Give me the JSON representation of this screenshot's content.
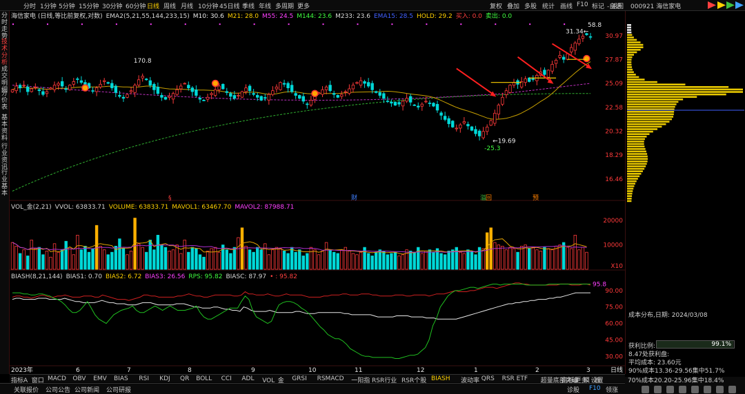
{
  "top_tabs": [
    "分时",
    "1分钟",
    "5分钟",
    "15分钟",
    "30分钟",
    "60分钟",
    "日线",
    "周线",
    "月线",
    "10分钟",
    "45日线",
    "季线",
    "年线",
    "多周期",
    "更多"
  ],
  "active_tab": "日线",
  "right_tabs": [
    "复权",
    "叠加",
    "多股",
    "统计",
    "画线",
    "F10",
    "标记",
    "-自选",
    "返回"
  ],
  "code_label": "000921 海信家电",
  "left_tabs": [
    "分时走势",
    "技术分析",
    "成交明细",
    "分价表",
    "基本资料",
    "行业资讯",
    "行业基本"
  ],
  "active_left": "技术分析",
  "main_legend": [
    {
      "t": "海信家电 (日线,等比前复权,对数)",
      "c": "#d8d8d8"
    },
    {
      "t": "EMA2(5,21,55,144,233,15)",
      "c": "#d8d8d8"
    },
    {
      "t": "M10: 30.6",
      "c": "#e8e8e8"
    },
    {
      "t": "M21: 28.0",
      "c": "#ffd000"
    },
    {
      "t": "M55: 24.5",
      "c": "#ff40ff"
    },
    {
      "t": "M144: 23.6",
      "c": "#40ff40"
    },
    {
      "t": "M233: 23.6",
      "c": "#d8d8d8"
    },
    {
      "t": "EMA15: 28.5",
      "c": "#4060ff"
    },
    {
      "t": "HOLD: 29.2",
      "c": "#ffd000"
    },
    {
      "t": "买入: 0.0",
      "c": "#ff4040"
    },
    {
      "t": "卖出: 0.0",
      "c": "#40ff40"
    }
  ],
  "price_axis": [
    "30.97",
    "27.87",
    "25.09",
    "22.58",
    "20.32",
    "18.29",
    "16.46"
  ],
  "annotations": {
    "high1": "170.8",
    "low1": "19.69",
    "low2": "-25.3",
    "last_high": "58.8",
    "last_price": "31.34"
  },
  "event_marks": [
    {
      "t": "§",
      "c": "#ff4040"
    },
    {
      "t": "财",
      "c": "#4080ff"
    },
    {
      "t": "溢",
      "c": "#40c040"
    },
    {
      "t": "回",
      "c": "#ff8000"
    },
    {
      "t": "预",
      "c": "#ff8000"
    }
  ],
  "vol_legend": [
    {
      "t": "VOL_金(2,21)",
      "c": "#d8d8d8"
    },
    {
      "t": "VVOL: 63833.71",
      "c": "#d8d8d8"
    },
    {
      "t": "VOLUME: 63833.71",
      "c": "#ffd000"
    },
    {
      "t": "MAVOL1: 63467.70",
      "c": "#ffd000"
    },
    {
      "t": "MAVOL2: 87988.71",
      "c": "#ff40ff"
    }
  ],
  "vol_axis": [
    "20000",
    "10000"
  ],
  "vol_unit": "X10",
  "bias_legend": [
    {
      "t": "BIASH(8,21,144)",
      "c": "#d8d8d8"
    },
    {
      "t": "BIAS1: 0.70",
      "c": "#d8d8d8"
    },
    {
      "t": "BIAS2: 6.72",
      "c": "#ffd000"
    },
    {
      "t": "BIAS3: 26.56",
      "c": "#ff40ff"
    },
    {
      "t": "RPS: 95.82",
      "c": "#40ff40"
    },
    {
      "t": "BIASC: 87.97",
      "c": "#d8d8d8"
    },
    {
      "t": "• : 95.82",
      "c": "#ff4040"
    }
  ],
  "bias_axis": [
    "90.00",
    "75.00",
    "60.00",
    "45.00",
    "30.00"
  ],
  "bias_last": "95.8",
  "date_axis": [
    "2023年",
    "6",
    "7",
    "8",
    "9",
    "10",
    "11",
    "12",
    "1",
    "2",
    "3"
  ],
  "date_axis_right": "日线",
  "bottom_tabs": [
    "指标A",
    "窗口",
    "MACD",
    "OBV",
    "EMV",
    "BIAS",
    "RSI",
    "KDJ",
    "QR",
    "BOLL",
    "CCI",
    "ADL",
    "VOL_金",
    "GRSI",
    "RSMACD",
    "一阳指",
    "RSR行业",
    "RSR个股",
    "BIASH",
    "波动率",
    "QRS",
    "RSR ETF",
    "超量底部突破",
    "更多",
    "设置"
  ],
  "active_bottom": "BIASH",
  "bottom_right_tabs": [
    "指标B",
    "模",
    "板"
  ],
  "bottom2": [
    "关联报价",
    "公司公告",
    "公司新闻",
    "公司研报"
  ],
  "bottom2_right": [
    "诊股",
    "F10",
    "领涨"
  ],
  "dist_panel": {
    "title": "成本分布,日期: 2024/03/08",
    "profit_label": "获利比例:",
    "profit_value": "99.1%",
    "profit_ratio": 0.991,
    "line3": "8.47处获利盘:",
    "avg_label": "平均成本: 23.60元",
    "line90": "90%成本13.36-29.56集中51.7%",
    "line70": "70%成本20.20-25.96集中18.4%"
  },
  "colors": {
    "up": "#ff3a3a",
    "down": "#00d8d8",
    "bg": "#000000",
    "grid": "#3a1010",
    "white": "#e8e8e8",
    "yellow": "#ffd000",
    "magenta": "#ff40ff",
    "green": "#40ff40"
  },
  "chart_data": [
    {
      "type": "candlestick",
      "title": "海信家电 (日线,等比前复权,对数)",
      "y_axis": [
        30.97,
        27.87,
        25.09,
        22.58,
        20.32,
        18.29,
        16.46
      ],
      "y_scale": "log",
      "x_labels": [
        "2023年",
        "6",
        "7",
        "8",
        "9",
        "10",
        "11",
        "12",
        "1",
        "2",
        "3"
      ],
      "closes": [
        24.4,
        24.8,
        24.6,
        24.9,
        24.2,
        24.5,
        24.7,
        24.3,
        23.9,
        24.2,
        24.6,
        24.9,
        25.1,
        24.8,
        24.5,
        24.9,
        25.3,
        25.6,
        25.2,
        24.9,
        24.6,
        24.3,
        24.6,
        25.0,
        25.4,
        25.1,
        24.6,
        24.1,
        23.7,
        23.5,
        23.9,
        24.3,
        24.9,
        25.5,
        25.9,
        25.5,
        24.9,
        24.4,
        24.0,
        23.6,
        23.4,
        23.7,
        24.0,
        24.4,
        24.8,
        25.1,
        24.6,
        24.2,
        23.8,
        23.4,
        23.3,
        23.6,
        24.0,
        24.4,
        24.8,
        24.5,
        24.1,
        23.7,
        23.5,
        23.8,
        24.2,
        24.6,
        24.3,
        23.9,
        23.6,
        23.3,
        23.5,
        23.9,
        24.3,
        24.7,
        25.2,
        25.0,
        24.6,
        24.2,
        23.8,
        23.5,
        23.2,
        22.9,
        23.3,
        23.7,
        24.1,
        24.4,
        24.7,
        24.3,
        23.9,
        23.6,
        23.9,
        24.2,
        24.5,
        24.9,
        25.2,
        25.4,
        25.1,
        24.8,
        24.4,
        24.1,
        23.8,
        23.5,
        23.2,
        23.0,
        22.8,
        22.9,
        23.2,
        23.5,
        23.1,
        22.8,
        22.6,
        22.9,
        23.2,
        23.0,
        22.7,
        22.3,
        21.8,
        21.4,
        21.0,
        20.7,
        20.6,
        20.9,
        21.2,
        20.8,
        20.4,
        20.1,
        19.9,
        20.3,
        20.7,
        21.3,
        22.0,
        22.8,
        23.6,
        24.3,
        24.9,
        25.2,
        25.0,
        25.3,
        25.6,
        25.3,
        25.6,
        26.0,
        26.4,
        26.1,
        26.6,
        27.3,
        27.8,
        28.4,
        27.9,
        28.6,
        29.4,
        30.0,
        30.5,
        30.9,
        31.1,
        30.8
      ]
    },
    {
      "type": "bar",
      "title": "VOL_金(2,21)",
      "y_axis": [
        20000,
        10000
      ],
      "unit": "X10",
      "values": [
        11000,
        9500,
        6500,
        8000,
        5500,
        12000,
        8500,
        9000,
        6000,
        7500,
        5000,
        10500,
        7000,
        8000,
        11500,
        9000,
        6000,
        14000,
        8000,
        9500,
        7000,
        8500,
        18000,
        9500,
        8000,
        6000,
        7000,
        9500,
        12500,
        8500,
        6000,
        7500,
        21000,
        10500,
        9000,
        7000,
        12000,
        8000,
        14000,
        10000,
        9000,
        7500,
        8000,
        10000,
        6500,
        12000,
        7000,
        9000,
        8500,
        6000,
        5000,
        7500,
        8500,
        9000,
        7000,
        10000,
        8000,
        6500,
        9000,
        13000,
        17000,
        9500,
        8000,
        7000,
        9000,
        8000,
        10500,
        6000,
        8000,
        9000,
        8500,
        7500,
        6500,
        9000,
        7000,
        8000,
        5500,
        6500,
        9000,
        8000,
        6000,
        7500,
        11000,
        8000,
        7000,
        6500,
        8000,
        9000,
        7500,
        6500,
        6000,
        7000,
        9000,
        6500,
        5500,
        7000,
        8000,
        7500,
        6000,
        6500,
        7000,
        5500,
        6000,
        8000,
        7500,
        7000,
        9000,
        6500,
        7500,
        8000,
        7000,
        8500,
        6500,
        6000,
        7500,
        8000,
        9000,
        7000,
        6500,
        8000,
        7500,
        6000,
        9000,
        8500,
        15000,
        17000,
        11000,
        10000,
        9500,
        8000,
        9000,
        8500,
        7000,
        9500,
        10000,
        8500,
        9000,
        8000,
        7500,
        9000,
        8500,
        8000,
        9500,
        10000,
        11000,
        9000,
        8500,
        14000,
        8000,
        9000,
        7000
      ]
    },
    {
      "type": "line",
      "title": "BIASH(8,21,144)",
      "y_axis": [
        90,
        75,
        60,
        45,
        30
      ],
      "series": [
        {
          "name": "BIAS2",
          "values": [
            84,
            85,
            85,
            84,
            84,
            83,
            84,
            85,
            86,
            85,
            84,
            84,
            85,
            85,
            86,
            85,
            84,
            84,
            84,
            85,
            85,
            85,
            84,
            84,
            86,
            85,
            84,
            83,
            82,
            82,
            82,
            81,
            82,
            83,
            84,
            86,
            86,
            85,
            85,
            84,
            84,
            84,
            84,
            84,
            85,
            85,
            86,
            87,
            86,
            85,
            85,
            84,
            84,
            85,
            86,
            86,
            86,
            86,
            86,
            85,
            85,
            86,
            89,
            87,
            87,
            86,
            86,
            86,
            87,
            86,
            85,
            85,
            86,
            87,
            86,
            86,
            86,
            86,
            85,
            84,
            84,
            84,
            84,
            85,
            85,
            86,
            86,
            86,
            87,
            87,
            86,
            86,
            86,
            87,
            87,
            87,
            86,
            86,
            85,
            85,
            85,
            85,
            86,
            86,
            86,
            85,
            85,
            86,
            86,
            86,
            86,
            85,
            86,
            87,
            87,
            87,
            88,
            89,
            90,
            89,
            89,
            89,
            90,
            90,
            91,
            92,
            93,
            93,
            93,
            92,
            93,
            94,
            95,
            96,
            97,
            97,
            96,
            96,
            95,
            95,
            95,
            95,
            95,
            95,
            95,
            95,
            96,
            96,
            96,
            95,
            95,
            95,
            96,
            96,
            95
          ]
        },
        {
          "name": "BIASC",
          "values": [
            82,
            83,
            83,
            82,
            82,
            82,
            82,
            83,
            83,
            83,
            82,
            82,
            82,
            82,
            83,
            82,
            81,
            80,
            80,
            79,
            79,
            79,
            79,
            80,
            81,
            80,
            79,
            79,
            78,
            78,
            78,
            77,
            77,
            77,
            78,
            79,
            79,
            79,
            78,
            77,
            77,
            77,
            77,
            77,
            78,
            78,
            78,
            77,
            76,
            75,
            75,
            74,
            74,
            74,
            75,
            75,
            74,
            73,
            73,
            72,
            72,
            71,
            75,
            74,
            72,
            71,
            71,
            71,
            71,
            72,
            71,
            70,
            70,
            70,
            70,
            70,
            71,
            71,
            70,
            69,
            69,
            69,
            70,
            70,
            70,
            70,
            70,
            70,
            70,
            69,
            69,
            68,
            68,
            68,
            68,
            68,
            68,
            67,
            66,
            66,
            66,
            66,
            66,
            67,
            67,
            67,
            67,
            66,
            66,
            66,
            66,
            65,
            65,
            65,
            64,
            64,
            64,
            64,
            64,
            64,
            65,
            66,
            67,
            68,
            69,
            70,
            71,
            72,
            73,
            74,
            75,
            76,
            77,
            78,
            78,
            79,
            79,
            80,
            80,
            81,
            81,
            82,
            82,
            82,
            83,
            83,
            84,
            84,
            85,
            86,
            87,
            88,
            88,
            88,
            88,
            88
          ]
        },
        {
          "name": "RPS",
          "values": [
            88,
            88,
            88,
            87,
            87,
            86,
            86,
            87,
            87,
            86,
            85,
            83,
            82,
            80,
            77,
            73,
            70,
            70,
            72,
            76,
            80,
            74,
            68,
            64,
            62,
            60,
            64,
            68,
            70,
            72,
            73,
            74,
            76,
            72,
            70,
            70,
            72,
            74,
            76,
            74,
            72,
            74,
            76,
            74,
            72,
            72,
            72,
            73,
            74,
            76,
            70,
            66,
            64,
            64,
            66,
            68,
            70,
            72,
            74,
            74,
            74,
            80,
            85,
            82,
            72,
            66,
            64,
            62,
            60,
            62,
            70,
            77,
            79,
            80,
            80,
            79,
            77,
            74,
            72,
            69,
            65,
            61,
            57,
            54,
            50,
            48,
            46,
            46,
            44,
            41,
            37,
            35,
            33,
            31,
            30,
            30,
            29,
            29,
            29,
            29,
            29,
            29,
            28,
            28,
            29,
            30,
            31,
            31,
            32,
            35,
            38,
            45,
            58,
            65,
            75,
            80,
            85,
            88,
            90,
            90,
            91,
            92,
            93,
            93,
            92,
            93,
            94,
            95,
            96,
            96,
            95,
            96,
            96,
            96,
            96,
            96,
            96,
            95,
            95,
            95,
            95,
            95,
            95,
            96,
            96,
            96,
            96,
            96,
            96,
            96,
            96,
            96,
            96,
            96,
            96
          ]
        }
      ]
    }
  ]
}
